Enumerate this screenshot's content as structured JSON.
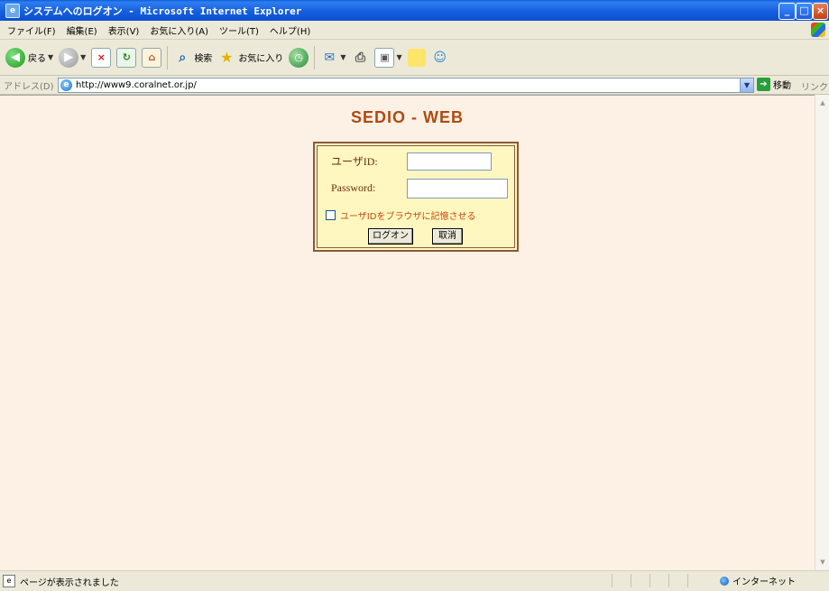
{
  "window": {
    "title": "システムへのログオン - Microsoft Internet Explorer"
  },
  "menu": [
    "ファイル(F)",
    "編集(E)",
    "表示(V)",
    "お気に入り(A)",
    "ツール(T)",
    "ヘルプ(H)"
  ],
  "toolbar": {
    "back_label": "戻る",
    "search_label": "検索",
    "favorites_label": "お気に入り"
  },
  "address": {
    "label": "アドレス(D)",
    "url": "http://www9.coralnet.or.jp/",
    "go_label": "移動",
    "links_label": "リンク"
  },
  "page": {
    "brand": "SEDIO - WEB",
    "login": {
      "userid_label": "ユーザID:",
      "password_label": "Password:",
      "userid_value": "",
      "password_value": "",
      "remember_label": "ユーザIDをブラウザに記憶させる",
      "remember_checked": false,
      "logon_button": "ログオン",
      "cancel_button": "取消"
    }
  },
  "status": {
    "text": "ページが表示されました",
    "zone": "インターネット"
  }
}
